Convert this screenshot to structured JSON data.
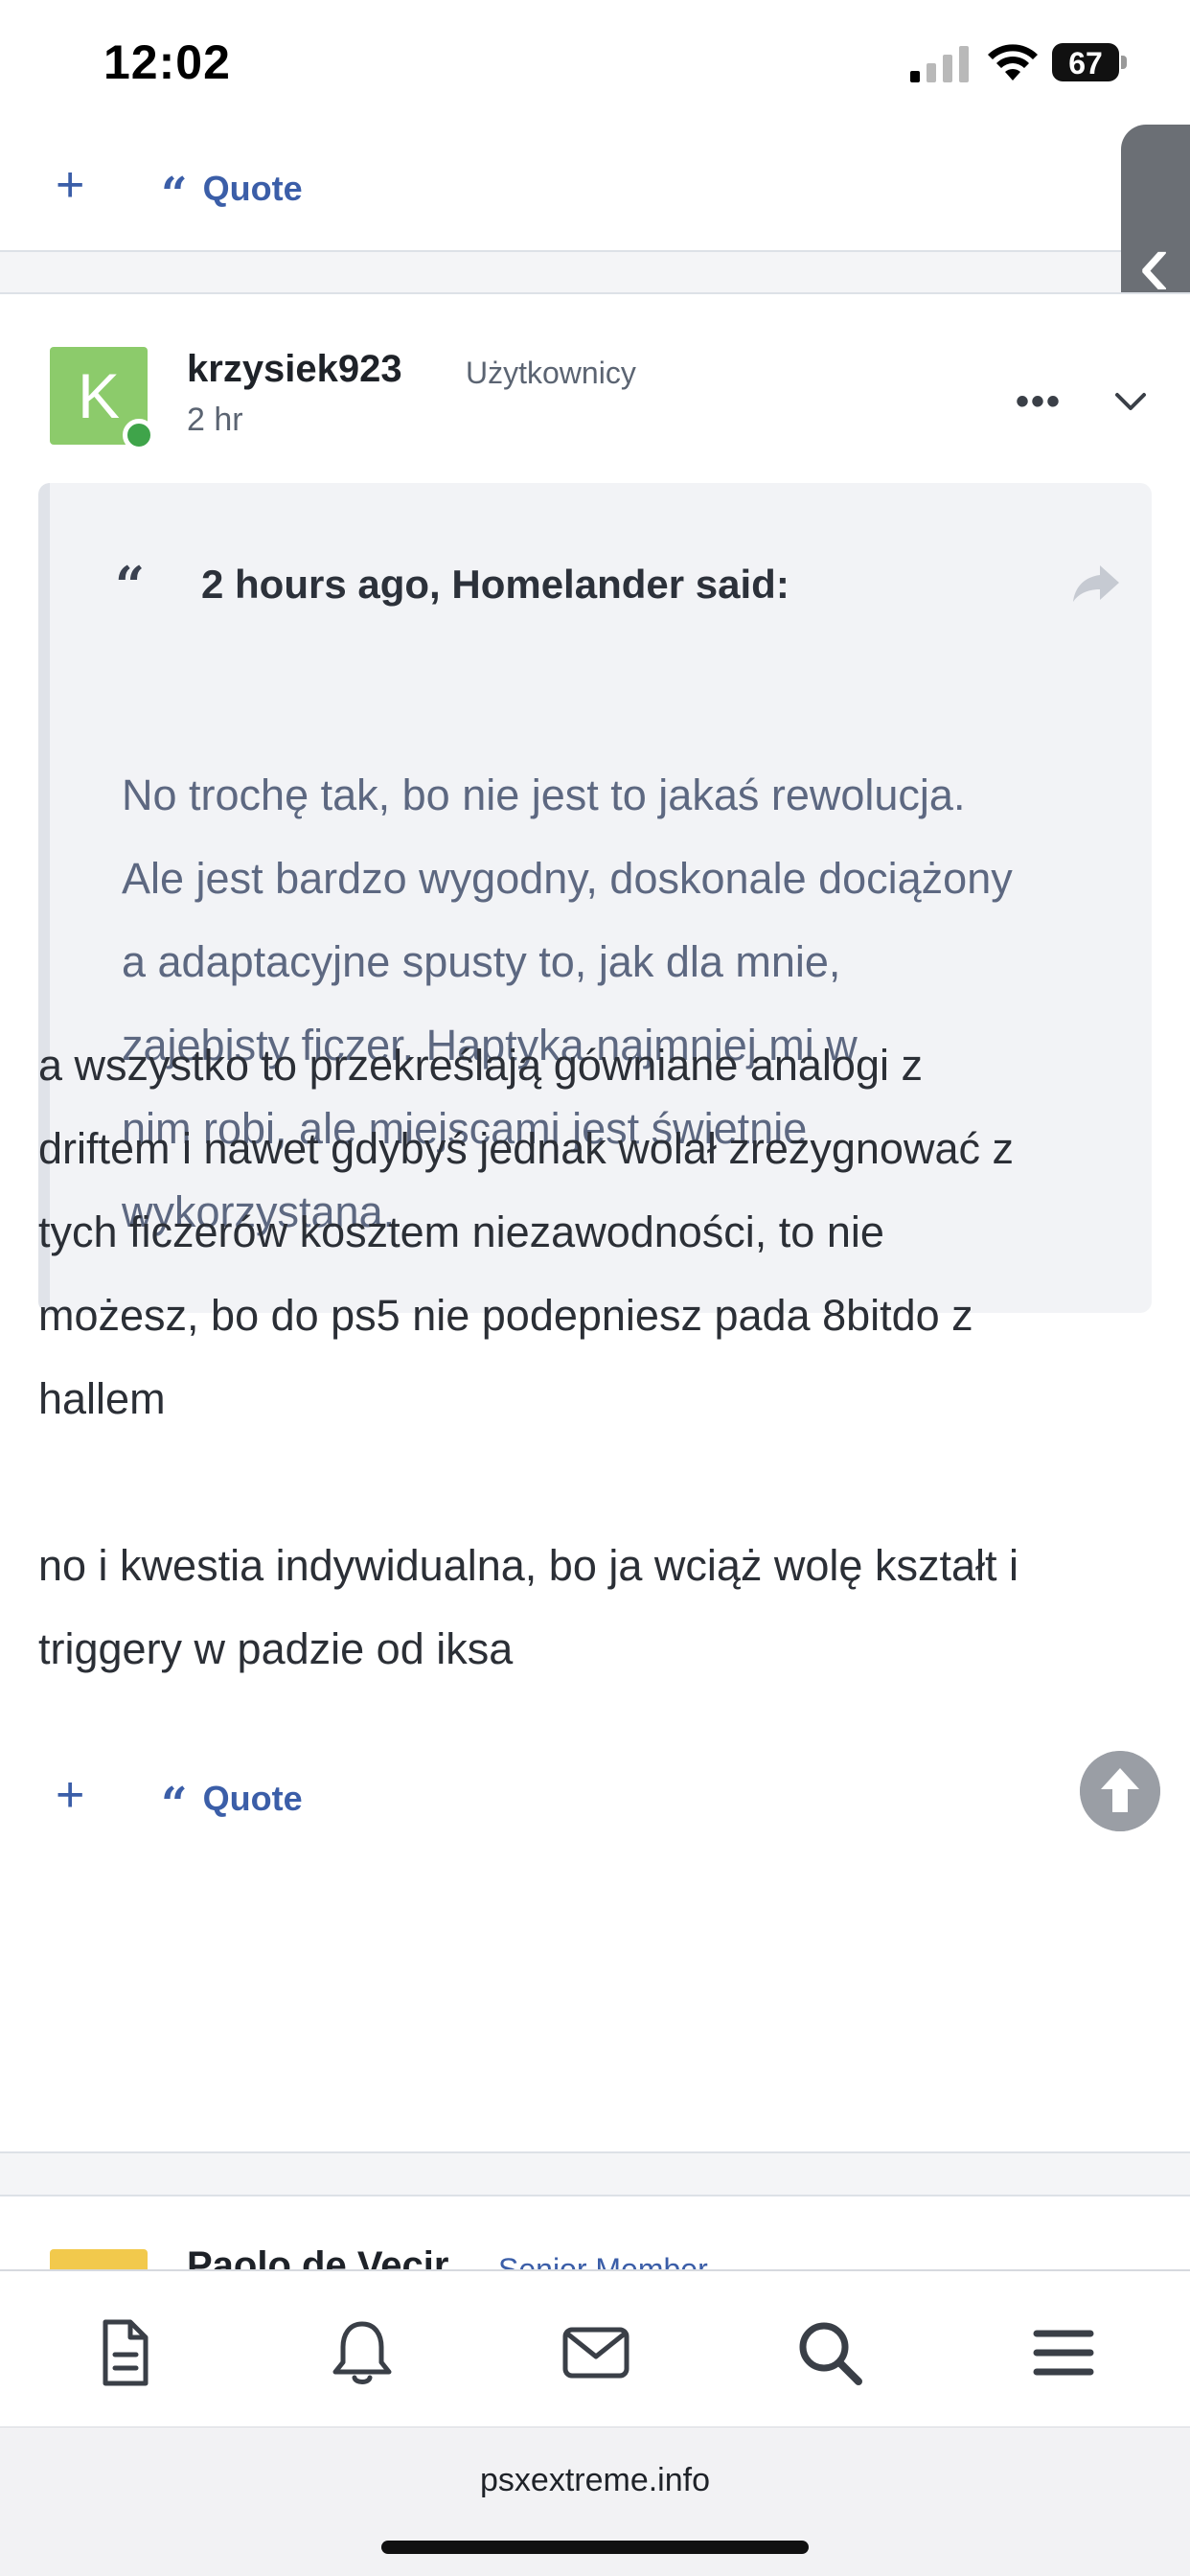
{
  "status_bar": {
    "time": "12:02",
    "battery": "67"
  },
  "prev_post_actions": {
    "react_label": "+",
    "quote_label": "Quote"
  },
  "post": {
    "avatar_letter": "K",
    "author": "krzysiek923",
    "group": "Użytkownicy",
    "time": "2 hr",
    "more_label": "•••",
    "quote": {
      "citation": "2 hours ago, Homelander said:",
      "lines": [
        "No trochę tak, bo nie jest to jakaś rewolucja.",
        "Ale jest bardzo wygodny, doskonale dociążony",
        "a adaptacyjne spusty to, jak dla mnie,",
        "zajebisty ficzer. Haptyka najmniej mi w",
        "nim robi, ale miejscami jest świetnie",
        "wykorzystana."
      ]
    },
    "body": {
      "lines_para1": [
        "a wszystko to przekreślają gówniane analogi z",
        "driftem i nawet gdybyś jednak wolał zrezygnować z",
        "tych ficzerów kosztem niezawodności, to nie",
        "możesz, bo do ps5 nie podepniesz pada 8bitdo z",
        "hallem"
      ],
      "lines_para2": [
        "no i kwestia indywidualna, bo ja wciąż wolę kształt i",
        "triggery w padzie od iksa"
      ]
    },
    "actions": {
      "react_label": "+",
      "quote_label": "Quote"
    }
  },
  "next_post": {
    "author": "Paolo de Vecir",
    "group": "Senior Member"
  },
  "bottom_nav": {
    "items": [
      {
        "icon": "document-icon"
      },
      {
        "icon": "bell-icon"
      },
      {
        "icon": "envelope-icon"
      },
      {
        "icon": "search-icon"
      },
      {
        "icon": "menu-icon"
      }
    ]
  },
  "browser": {
    "url": "psxextreme.info"
  },
  "colors": {
    "accent": "#3b5ea8",
    "avatar_bg": "#8ccb6b",
    "online": "#3fa44a",
    "quote_text": "#5d6881"
  }
}
